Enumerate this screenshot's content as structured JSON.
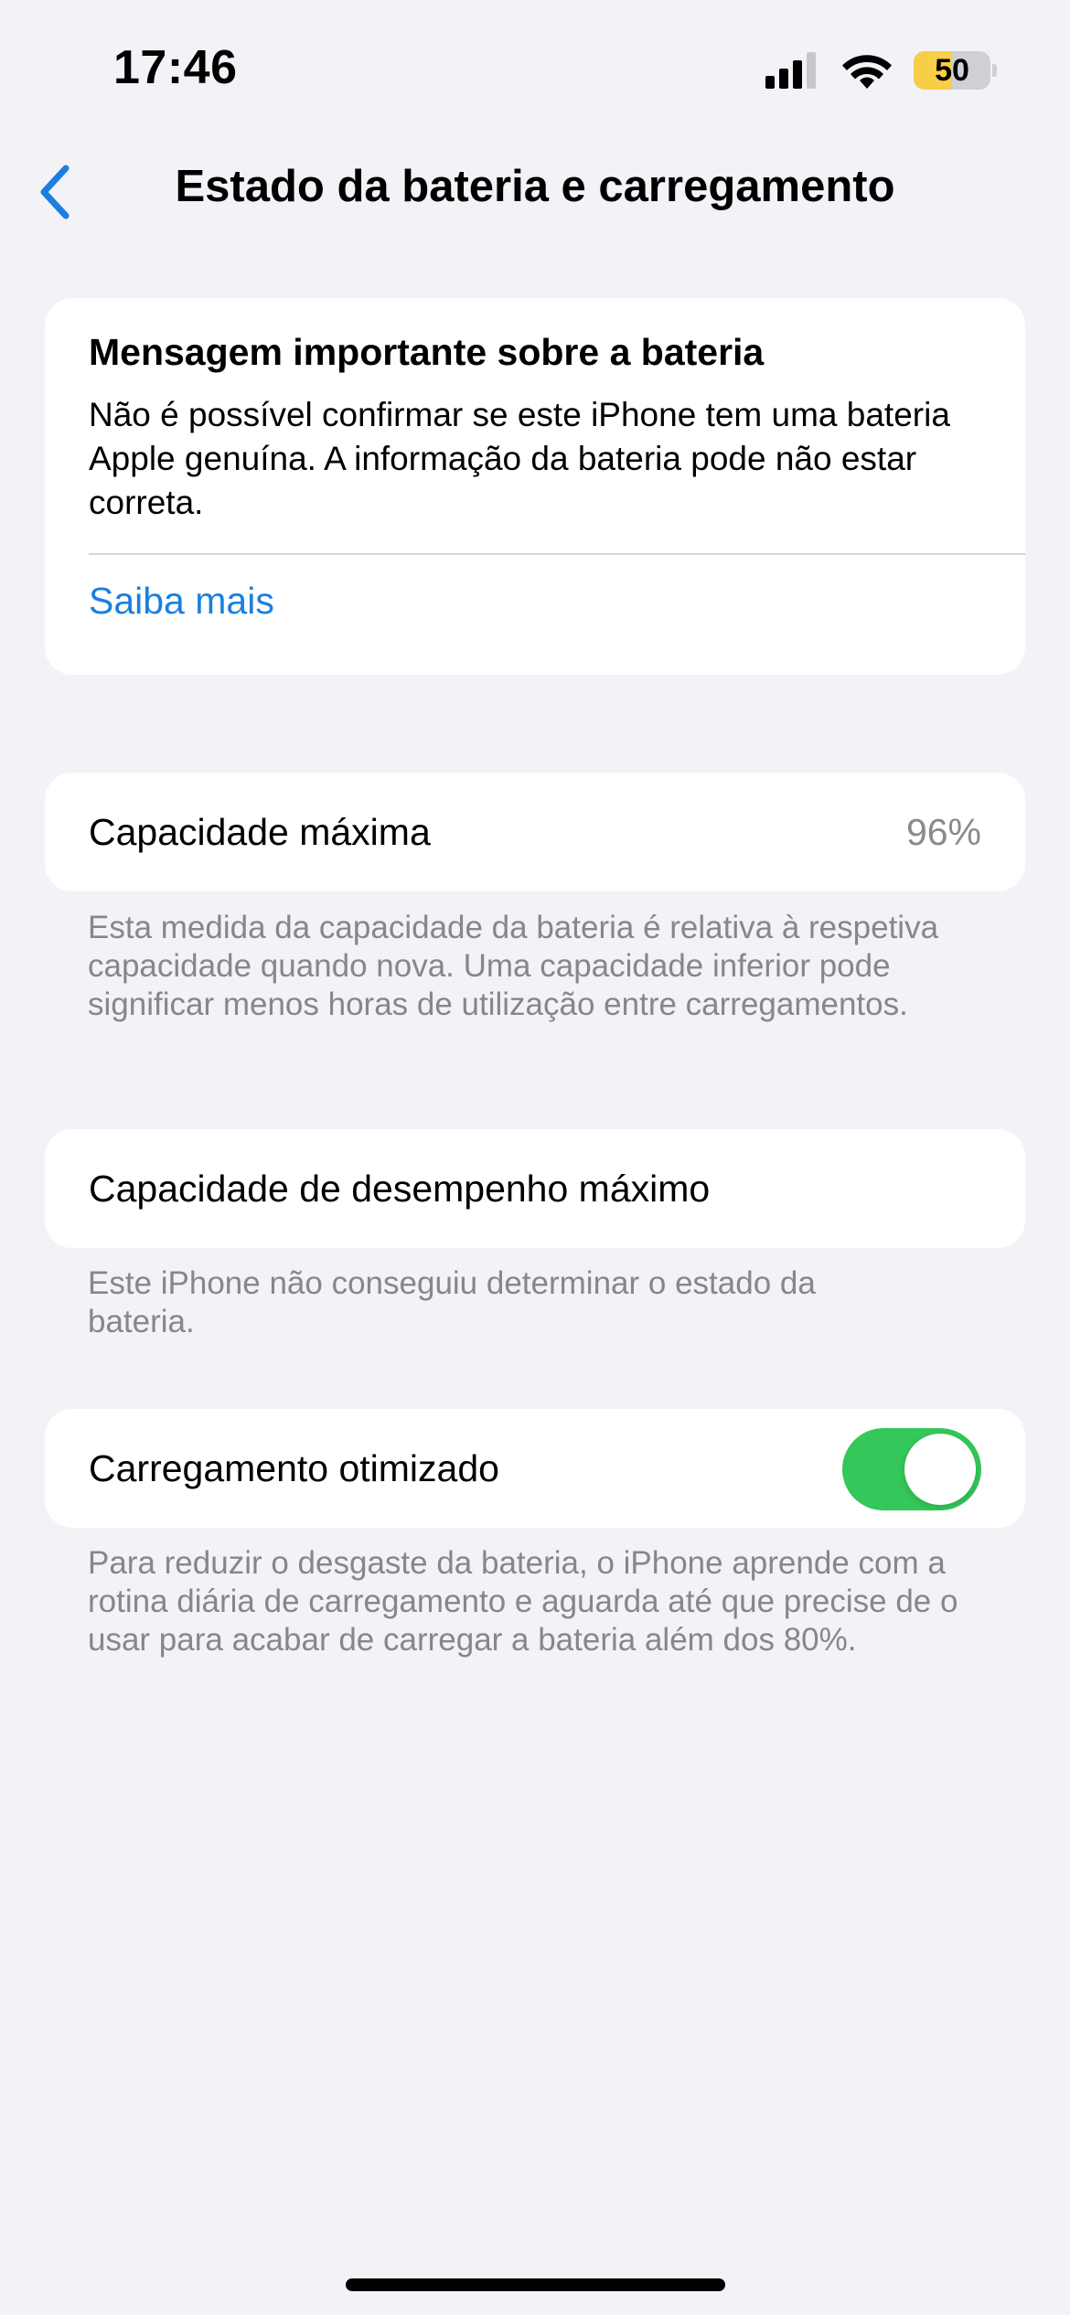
{
  "status_bar": {
    "time": "17:46",
    "battery_level": "50",
    "battery_fraction": 0.5,
    "battery_color": "#f7ce46",
    "icons": [
      "signal-icon",
      "wifi-icon",
      "battery-icon"
    ]
  },
  "nav": {
    "back_icon": "chevron-left-icon",
    "title": "Estado da bateria e carregamento"
  },
  "message": {
    "title": "Mensagem importante sobre a bateria",
    "body": "Não é possível confirmar se este iPhone tem uma bateria Apple genuína. A informação da bateria pode não estar correta.",
    "link": "Saiba mais"
  },
  "capacity": {
    "label": "Capacidade máxima",
    "value": "96%",
    "note": "Esta medida da capacidade da bateria é relativa à respetiva capacidade quando nova. Uma capacidade inferior pode significar menos horas de utilização entre carregamentos."
  },
  "performance": {
    "label": "Capacidade de desempenho máximo",
    "note": "Este iPhone não conseguiu determinar o estado da bateria."
  },
  "charging": {
    "label": "Carregamento otimizado",
    "enabled": true,
    "toggle_color": "#34c759",
    "note": "Para reduzir o desgaste da bateria, o iPhone aprende com a rotina diária de carregamento e aguarda até que precise de o usar para acabar de carregar a bateria além dos 80%."
  },
  "colors": {
    "accent": "#1a7fe0",
    "background": "#f2f2f7",
    "secondary_text": "#86868b"
  }
}
